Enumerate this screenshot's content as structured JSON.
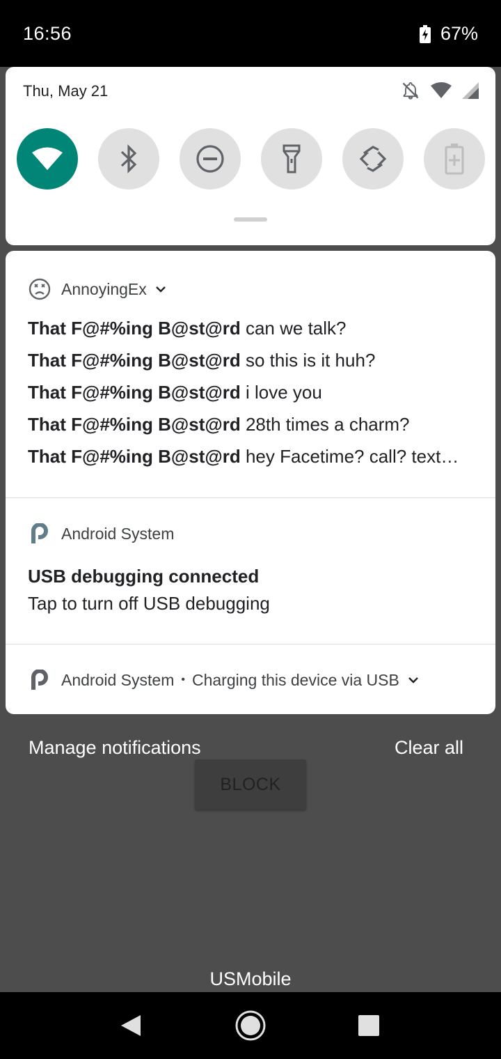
{
  "status_bar": {
    "time": "16:56",
    "battery_percent": "67%",
    "icons": [
      "battery-charging-icon"
    ]
  },
  "quick_settings": {
    "date": "Thu, May 21",
    "status_icons": [
      "notifications-off-icon",
      "wifi-icon",
      "signal-icon"
    ],
    "tiles": [
      {
        "name": "wifi",
        "icon": "wifi-icon",
        "active": true
      },
      {
        "name": "bluetooth",
        "icon": "bluetooth-icon",
        "active": false
      },
      {
        "name": "do-not-disturb",
        "icon": "dnd-icon",
        "active": false
      },
      {
        "name": "flashlight",
        "icon": "flashlight-icon",
        "active": false
      },
      {
        "name": "auto-rotate",
        "icon": "rotate-icon",
        "active": false
      },
      {
        "name": "battery-saver",
        "icon": "battery-saver-icon",
        "active": false
      }
    ],
    "accent_color": "#008577"
  },
  "notifications": {
    "annoying": {
      "app_name": "AnnoyingEx",
      "icon": "sad-face-icon",
      "messages": [
        {
          "sender": "That F@#%ing B@st@rd",
          "text": "can we talk?"
        },
        {
          "sender": "That F@#%ing B@st@rd",
          "text": "so this is it huh?"
        },
        {
          "sender": "That F@#%ing B@st@rd",
          "text": "i love you"
        },
        {
          "sender": "That F@#%ing B@st@rd",
          "text": "28th times a charm?"
        },
        {
          "sender": "That F@#%ing B@st@rd",
          "text": "hey Facetime? call? text…"
        }
      ]
    },
    "usb_debugging": {
      "app_name": "Android System",
      "title": "USB debugging connected",
      "text": "Tap to turn off USB debugging"
    },
    "charging": {
      "app_name": "Android System",
      "separator": "•",
      "summary": "Charging this device via USB"
    }
  },
  "footer": {
    "manage": "Manage notifications",
    "clear_all": "Clear all"
  },
  "background_app": {
    "block_button": "BLOCK",
    "carrier": "USMobile"
  },
  "nav_bar": {
    "buttons": [
      "back-icon",
      "home-icon",
      "recents-icon"
    ]
  }
}
